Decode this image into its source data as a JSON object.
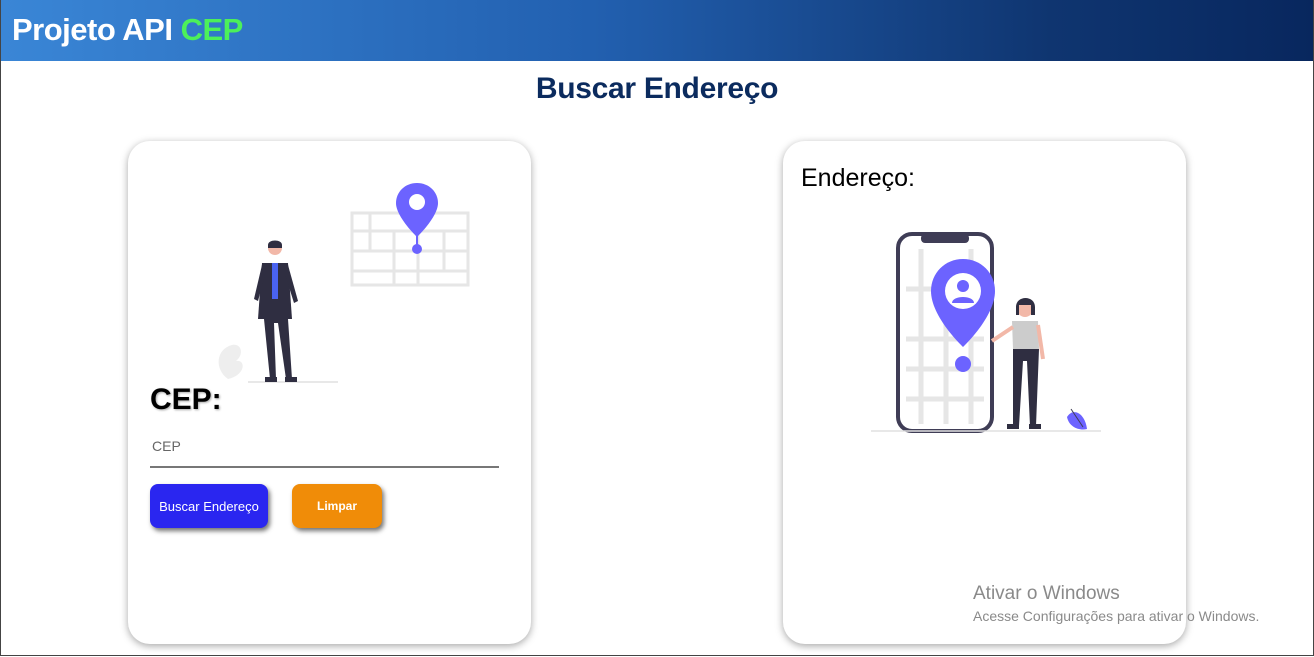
{
  "header": {
    "brand_main": "Projeto API",
    "brand_accent": "CEP"
  },
  "main": {
    "title": "Buscar Endereço"
  },
  "search_card": {
    "cep_label": "CEP:",
    "cep_input": {
      "placeholder": "CEP",
      "value": ""
    },
    "search_button": "Buscar Endereço",
    "clear_button": "Limpar"
  },
  "result_card": {
    "address_label": "Endereço:"
  },
  "watermark": {
    "title": "Ativar o Windows",
    "subtitle": "Acesse Configurações para ativar o Windows."
  },
  "colors": {
    "header_start": "#3a86d6",
    "header_end": "#08275e",
    "accent_green": "#4cf05a",
    "title": "#0b2b5e",
    "search_button": "#2a26f0",
    "clear_button": "#f08c08",
    "illustration_purple": "#6c63ff"
  },
  "icons": [
    "map-pin-icon",
    "phone-map-icon",
    "leaf-icon"
  ]
}
